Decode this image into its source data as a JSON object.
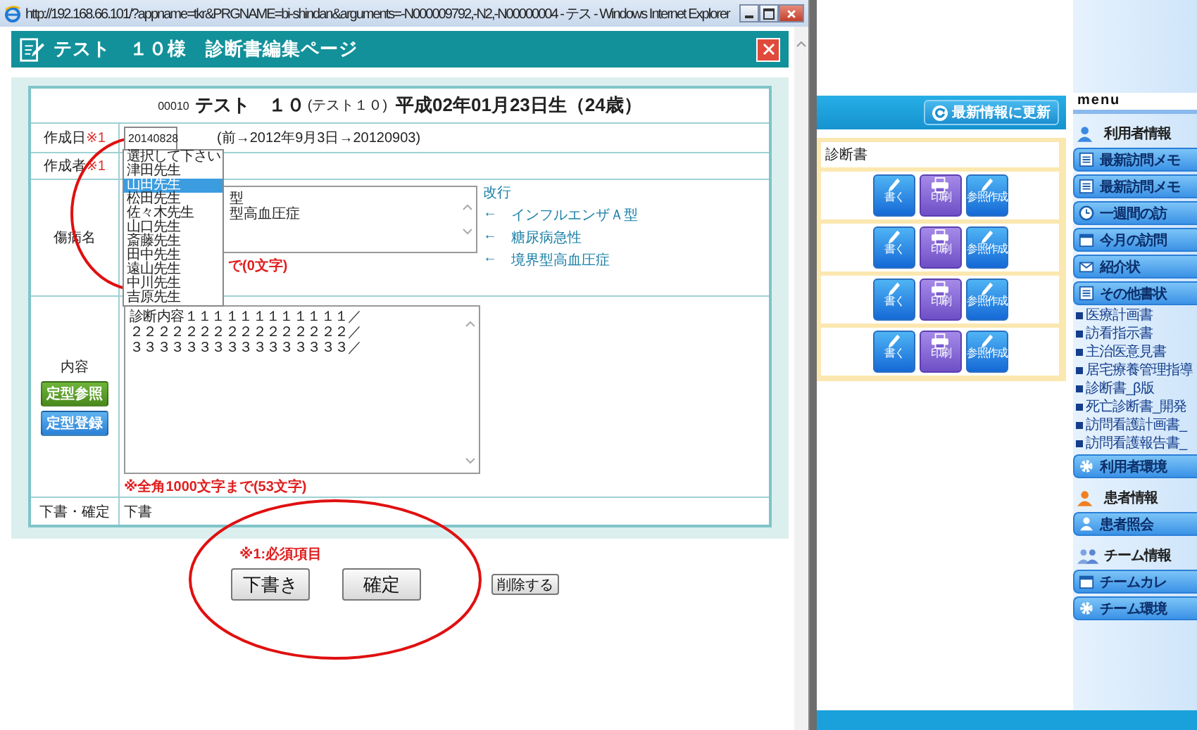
{
  "browser_window": {
    "title": "http://192.168.66.101/?appname=tkr&PRGNAME=bi-shindan&arguments=-N000009792,-N2,-N00000004 - テス - Windows Internet Explorer"
  },
  "dialog": {
    "title": "テスト　１０様　診断書編集ページ",
    "patient": {
      "id": "00010",
      "name": "テスト　１０",
      "kana": "(テスト１０)",
      "birth": "平成02年01月23日生（24歳）"
    },
    "created_date": {
      "label": "作成日",
      "required": "※1",
      "value": "20140828",
      "note": "(前→2012年9月3日→20120903)"
    },
    "author": {
      "label": "作成者",
      "required": "※1",
      "options": [
        {
          "label": "選択して下さい",
          "selected": false
        },
        {
          "label": "津田先生",
          "selected": false
        },
        {
          "label": "山田先生",
          "selected": true
        },
        {
          "label": "松田先生",
          "selected": false
        },
        {
          "label": "佐々木先生",
          "selected": false
        },
        {
          "label": "山口先生",
          "selected": false
        },
        {
          "label": "斎藤先生",
          "selected": false
        },
        {
          "label": "田中先生",
          "selected": false
        },
        {
          "label": "遠山先生",
          "selected": false
        },
        {
          "label": "中川先生",
          "selected": false
        },
        {
          "label": "吉原先生",
          "selected": false
        }
      ]
    },
    "diagnosis": {
      "label": "傷病名",
      "lines": [
        "型",
        "型高血圧症"
      ],
      "counter": "で(0文字)",
      "hint": "改行",
      "suggestions": [
        {
          "arrow": "←",
          "text": "インフルエンザＡ型"
        },
        {
          "arrow": "←",
          "text": "糖尿病急性"
        },
        {
          "arrow": "←",
          "text": "境界型高血圧症"
        }
      ]
    },
    "content": {
      "label": "内容",
      "buttons": [
        {
          "kind": "reference",
          "label": "定型参照"
        },
        {
          "kind": "register",
          "label": "定型登録"
        }
      ],
      "lines": [
        "診断内容１１１１１１１１１１１１／",
        "２２２２２２２２２２２２２２２２／",
        "３３３３３３３３３３３３３３３３／"
      ],
      "counter": "※全角1000文字まで(53文字)"
    },
    "status": {
      "label": "下書・確定",
      "value": "下書"
    },
    "required_note": "※1:必須項目",
    "actions": [
      {
        "kind": "large",
        "label": "下書き"
      },
      {
        "kind": "large",
        "label": "確定"
      },
      {
        "kind": "small",
        "label": "削除する"
      }
    ]
  },
  "background_page": {
    "refresh_button": "最新情報に更新",
    "panel": {
      "title": "診断書",
      "rows": [
        {
          "buttons": [
            {
              "kind": "write",
              "label": "書く"
            },
            {
              "kind": "print",
              "label": "印刷"
            },
            {
              "kind": "reference",
              "label": "参照作成"
            }
          ]
        },
        {
          "buttons": [
            {
              "kind": "write",
              "label": "書く"
            },
            {
              "kind": "print",
              "label": "印刷"
            },
            {
              "kind": "reference",
              "label": "参照作成"
            }
          ]
        },
        {
          "buttons": [
            {
              "kind": "write",
              "label": "書く"
            },
            {
              "kind": "print",
              "label": "印刷"
            },
            {
              "kind": "reference",
              "label": "参照作成"
            }
          ]
        },
        {
          "buttons": [
            {
              "kind": "write",
              "label": "書く"
            },
            {
              "kind": "print",
              "label": "印刷"
            },
            {
              "kind": "reference",
              "label": "参照作成"
            }
          ]
        }
      ]
    },
    "menu": {
      "title": "menu",
      "sections": [
        {
          "kind": "user",
          "heading": "利用者情報",
          "items": [
            {
              "kind": "memo",
              "label": "最新訪問メモ"
            },
            {
              "kind": "memo",
              "label": "最新訪問メモ"
            },
            {
              "kind": "clock",
              "label": "一週間の訪"
            },
            {
              "kind": "calendar",
              "label": "今月の訪問"
            },
            {
              "kind": "mail",
              "label": "紹介状"
            },
            {
              "kind": "memo",
              "label": "その他書状"
            },
            {
              "kind": "link",
              "label": "医療計画書"
            },
            {
              "kind": "link",
              "label": "訪看指示書"
            },
            {
              "kind": "link",
              "label": "主治医意見書"
            },
            {
              "kind": "link",
              "label": "居宅療養管理指導"
            },
            {
              "kind": "link",
              "label": "診断書_β版"
            },
            {
              "kind": "link",
              "label": "死亡診断書_開発"
            },
            {
              "kind": "link",
              "label": "訪問看護計画書_"
            },
            {
              "kind": "link",
              "label": "訪問看護報告書_"
            },
            {
              "kind": "gear",
              "label": "利用者環境"
            }
          ]
        },
        {
          "kind": "patient",
          "heading": "患者情報",
          "items": [
            {
              "kind": "person",
              "label": "患者照会"
            }
          ]
        },
        {
          "kind": "team",
          "heading": "チーム情報",
          "items": [
            {
              "kind": "calendar",
              "label": "チームカレ"
            },
            {
              "kind": "gear",
              "label": "チーム環境"
            }
          ]
        }
      ]
    }
  }
}
